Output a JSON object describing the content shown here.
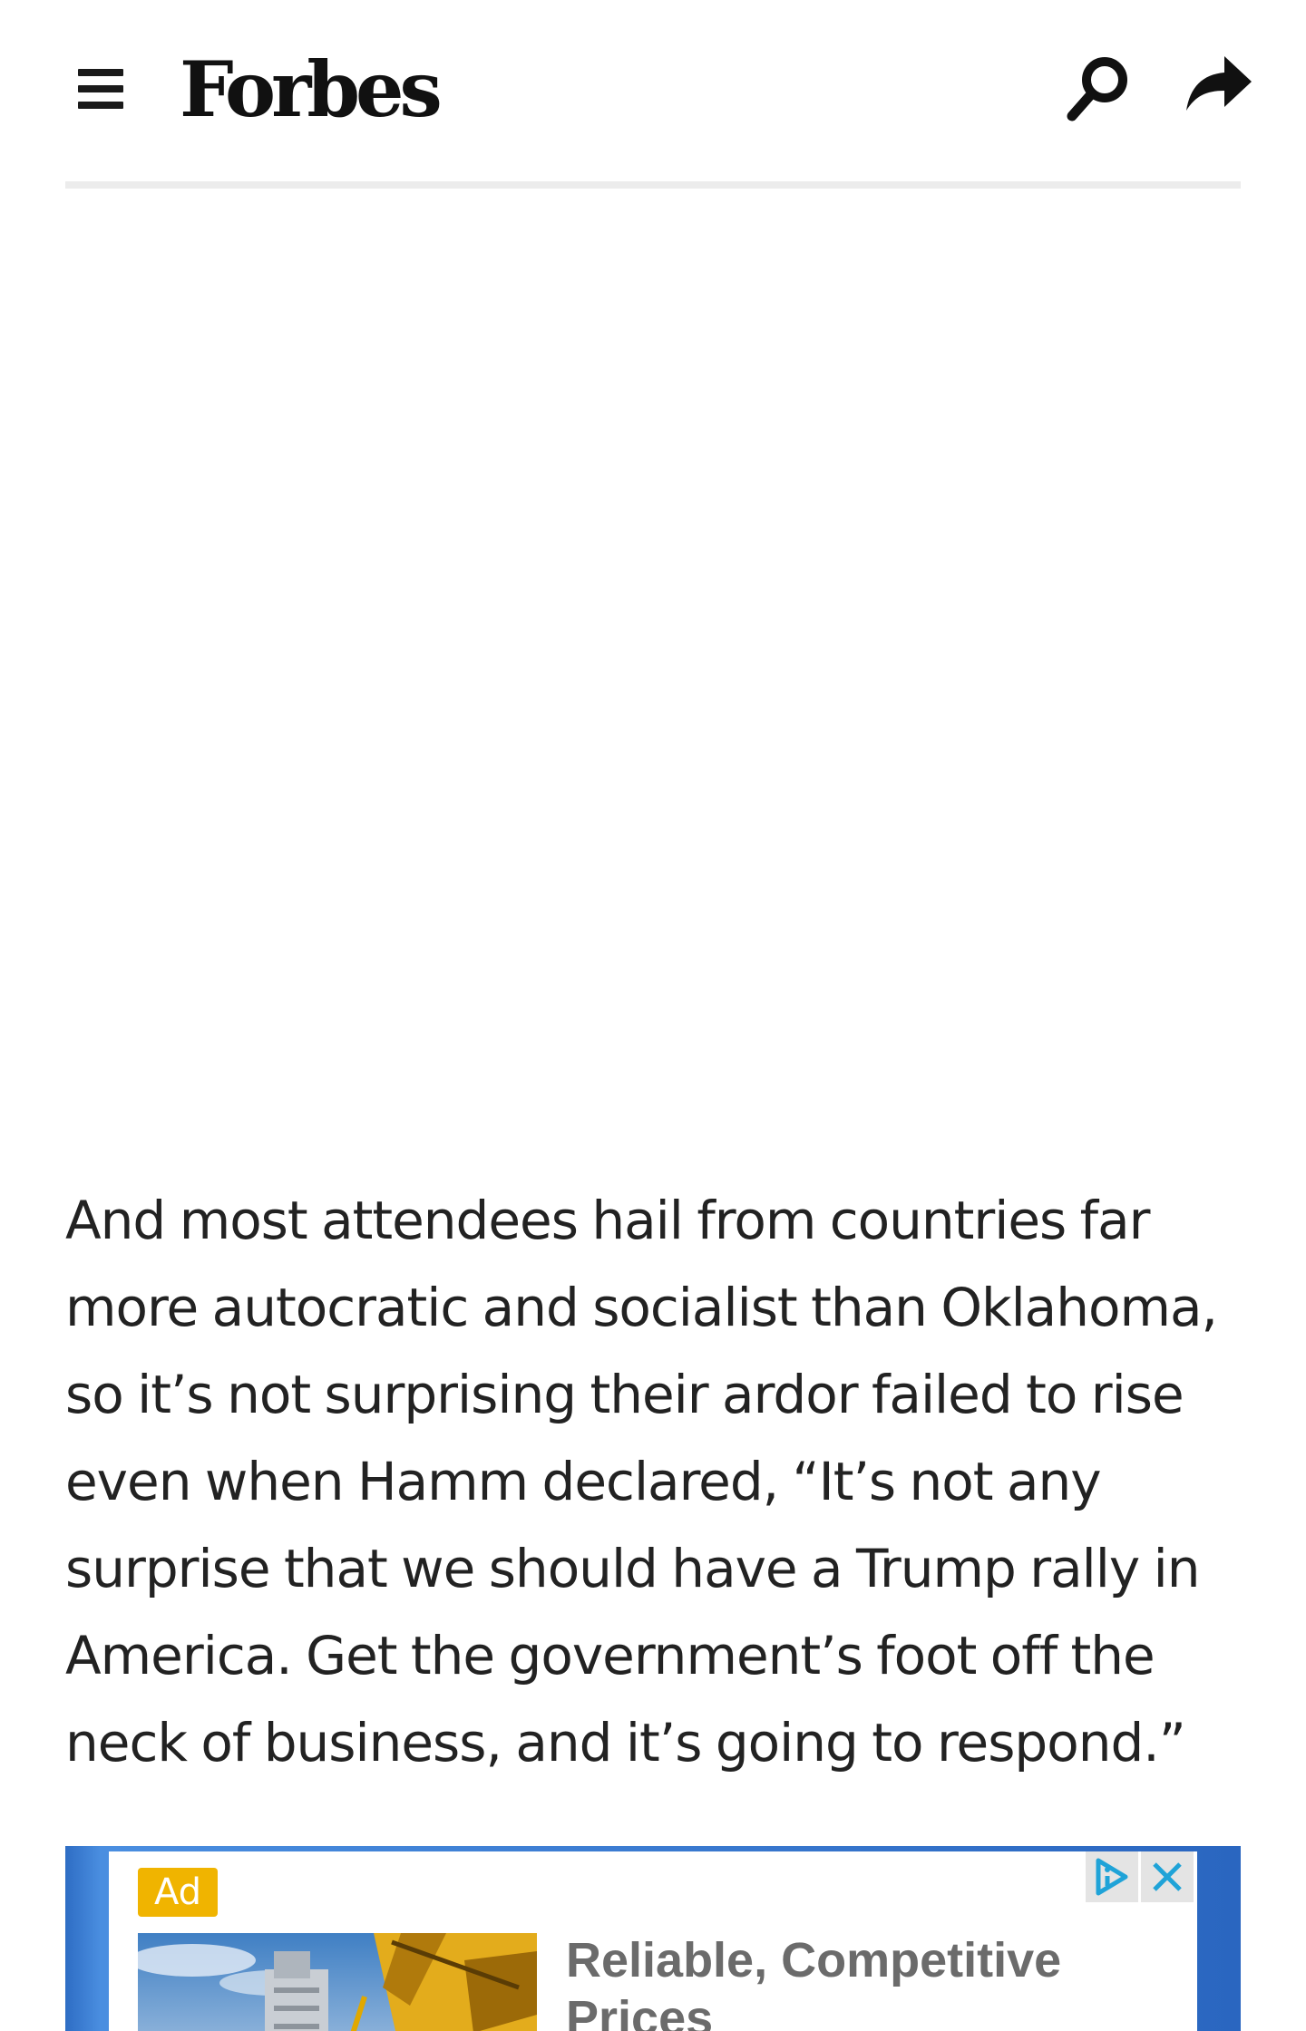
{
  "header": {
    "menu_icon": "hamburger-menu-icon",
    "logo_text": "Forbes",
    "search_icon": "search-icon",
    "share_icon": "share-icon"
  },
  "article": {
    "paragraph": "And most attendees hail from countries far more autocratic and socialist than Oklahoma, so it’s not surprising their ardor failed to rise even when Hamm declared, “It’s not any surprise that we should have a Trump rally in America. Get the government’s foot off the neck of business, and it’s going to respond.”"
  },
  "ad": {
    "badge_label": "Ad",
    "headline": "Reliable, Competitive Prices",
    "adchoices_icon": "adchoices-icon",
    "close_icon": "close-icon",
    "badge_color": "#f0b400",
    "frame_color": "#2e6dc4",
    "adchoices_color": "#1fa3d8"
  },
  "colors": {
    "text": "#222222",
    "rule": "#ececec",
    "logo": "#111111"
  }
}
